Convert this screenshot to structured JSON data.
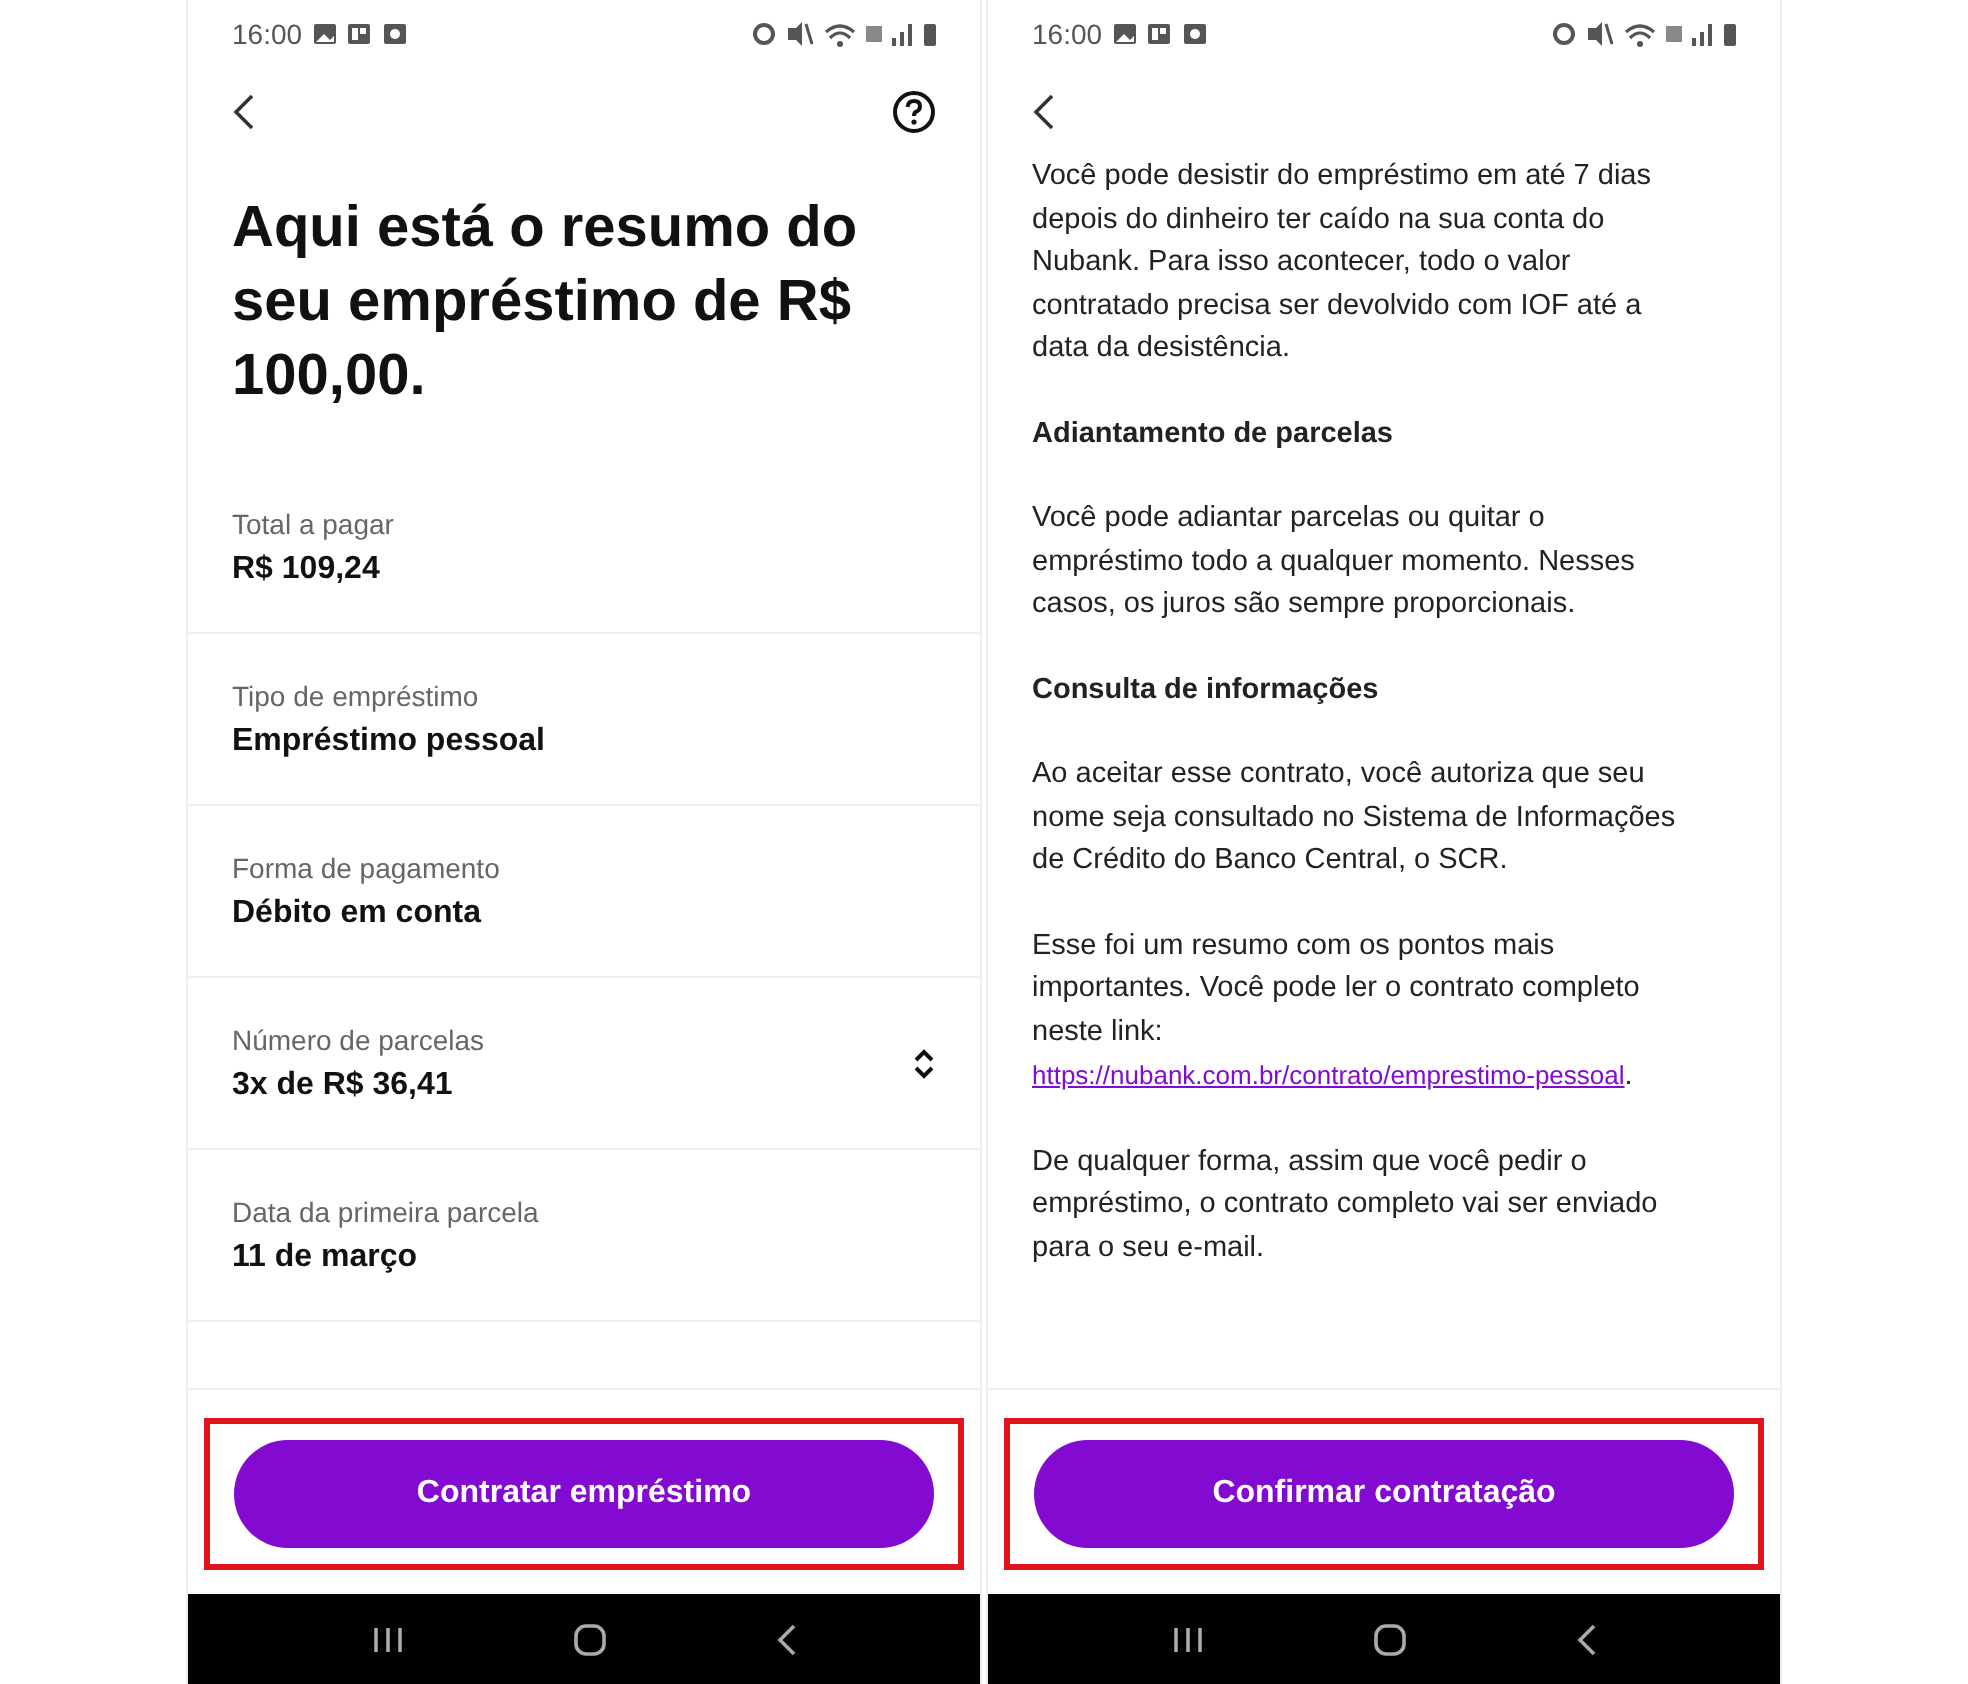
{
  "screens": [
    {
      "kind": "summary",
      "status_bar": {
        "time": "16:00"
      },
      "header": {
        "help": true
      },
      "title": "Aqui está o resumo do seu empréstimo de R$ 100,00.",
      "summary": [
        {
          "label": "Total a pagar",
          "value": "R$ 109,24",
          "expandable": false
        },
        {
          "label": "Tipo de empréstimo",
          "value": "Empréstimo pessoal",
          "expandable": false
        },
        {
          "label": "Forma de pagamento",
          "value": "Débito em conta",
          "expandable": false
        },
        {
          "label": "Número de parcelas",
          "value": "3x de R$ 36,41",
          "expandable": true
        },
        {
          "label": "Data da primeira parcela",
          "value": "11 de março",
          "expandable": false
        }
      ],
      "button": {
        "label": "Contratar empréstimo",
        "highlighted": true
      }
    },
    {
      "kind": "contract",
      "status_bar": {
        "time": "16:00"
      },
      "header": {
        "help": false
      },
      "paragraphs": [
        {
          "kind": "text",
          "text": "Você pode desistir do empréstimo em até 7 dias depois do dinheiro ter caído na sua conta do Nubank. Para isso acontecer, todo o valor contratado precisa ser devolvido com IOF até a data da desistência."
        },
        {
          "kind": "heading",
          "text": "Adiantamento de parcelas"
        },
        {
          "kind": "text",
          "text": "Você pode adiantar parcelas ou quitar o empréstimo todo a qualquer momento. Nesses casos, os juros são sempre proporcionais."
        },
        {
          "kind": "heading",
          "text": "Consulta de informações"
        },
        {
          "kind": "text",
          "text": "Ao aceitar esse contrato, você autoriza que seu nome seja consultado no Sistema de Informações de Crédito do Banco Central, o SCR."
        },
        {
          "kind": "link",
          "text": "Esse foi um resumo com os pontos mais importantes. Você pode ler o contrato completo neste link:",
          "link": "https://nubank.com.br/contrato/emprestimo-pessoal",
          "after": "."
        },
        {
          "kind": "text",
          "text": "De qualquer forma, assim que você pedir o empréstimo, o contrato completo vai ser enviado para o seu e-mail."
        }
      ],
      "button": {
        "label": "Confirmar contratação",
        "highlighted": true
      }
    }
  ]
}
